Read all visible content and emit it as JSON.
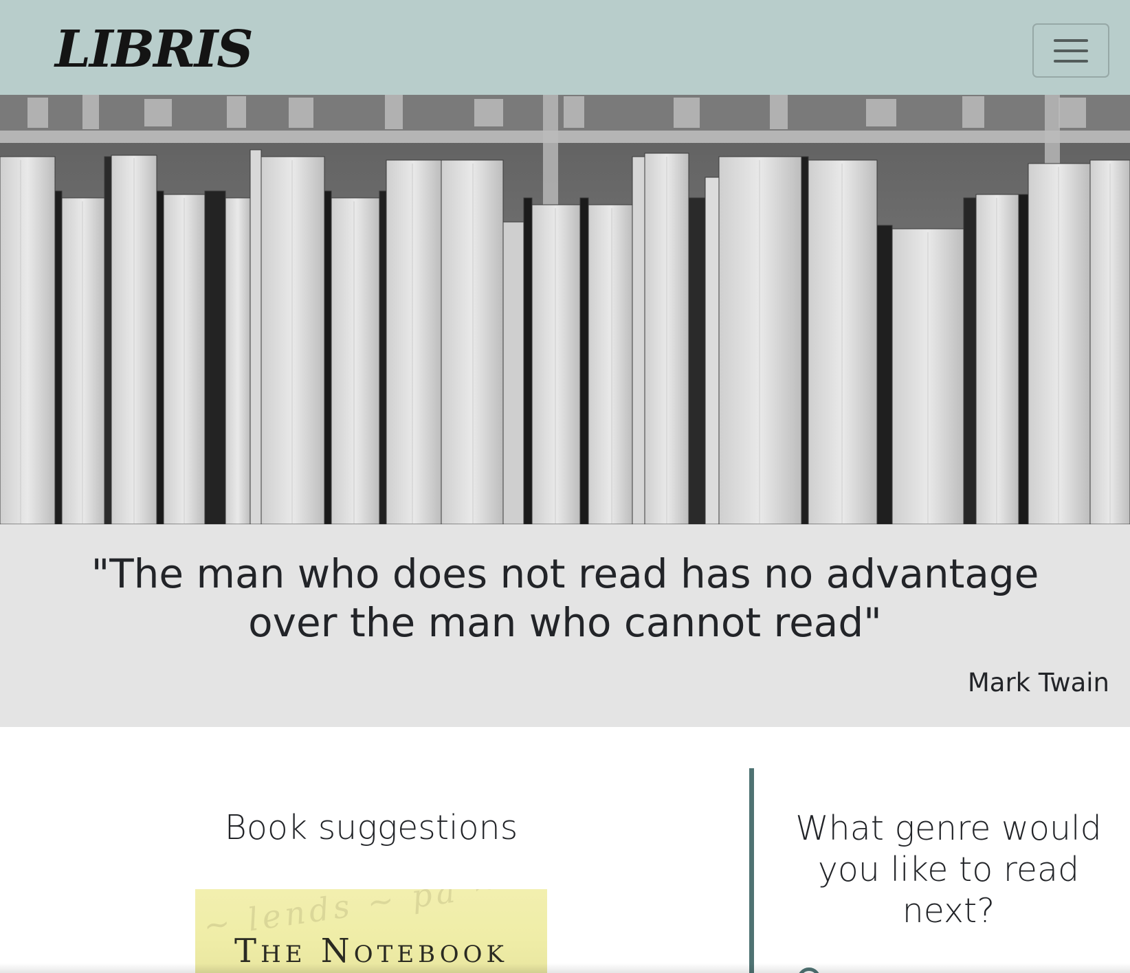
{
  "navbar": {
    "brand": "LIBRIS",
    "toggle_icon": "hamburger-menu-icon",
    "background": "#b8cdcb"
  },
  "hero": {
    "image": "grayscale photo of book spines on a library shelf"
  },
  "quote": {
    "text": "\"The man who does not read has no advantage over the man who cannot read\"",
    "author": "Mark Twain",
    "background": "#e4e4e4"
  },
  "suggestions": {
    "title": "Book suggestions",
    "book": {
      "title": "The Notebook"
    }
  },
  "genre": {
    "title": "What genre would you like to read next?",
    "accent": "#4f7373"
  }
}
